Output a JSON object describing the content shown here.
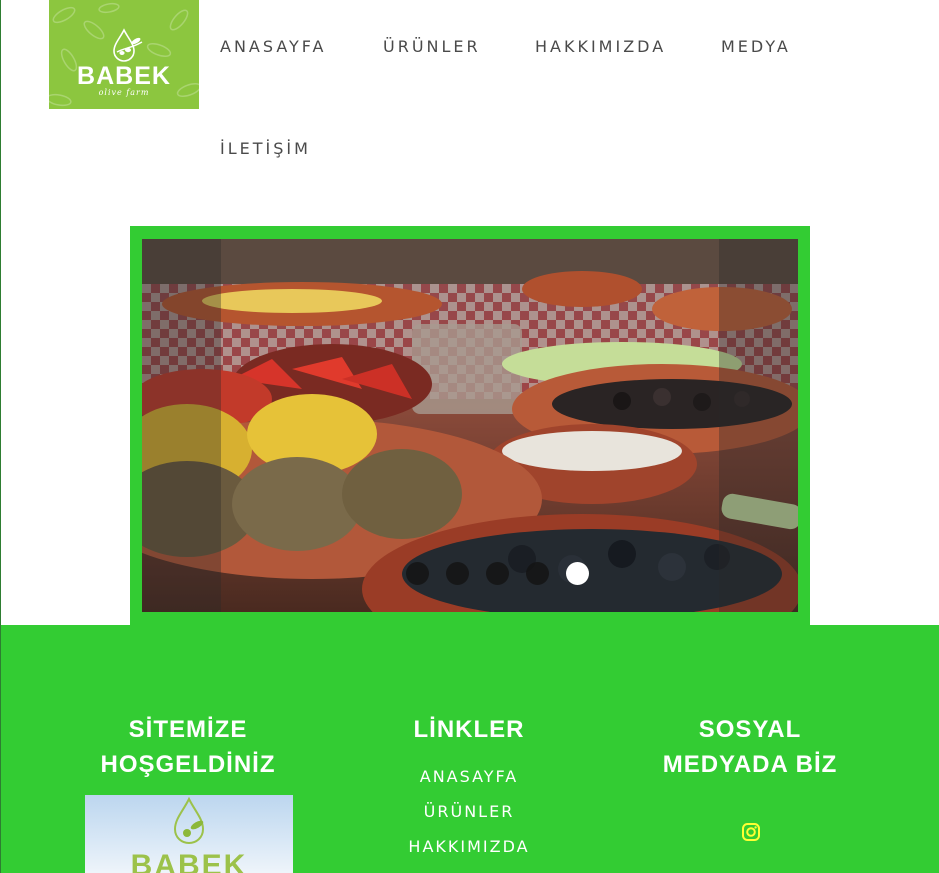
{
  "logo": {
    "brand": "BABEK",
    "sub": "olive farm",
    "color": "#8cc63f"
  },
  "nav": {
    "items": [
      {
        "label": "ANASAYFA"
      },
      {
        "label": "ÜRÜNLER"
      },
      {
        "label": "HAKKIMIZDA"
      },
      {
        "label": "MEDYA"
      },
      {
        "label": "İLETİŞİM"
      }
    ]
  },
  "slider": {
    "frame_color": "#33cc33",
    "slide_count": 5,
    "active_slide": 5
  },
  "footer": {
    "bg_color": "#33cc33",
    "welcome": {
      "title_line1": "SİTEMİZE",
      "title_line2": "HOŞGELDİNİZ",
      "image_text": "BABEK"
    },
    "links": {
      "title": "LİNKLER",
      "items": [
        "ANASAYFA",
        "ÜRÜNLER",
        "HAKKIMIZDA"
      ]
    },
    "social": {
      "title_line1": "SOSYAL",
      "title_line2": "MEDYADA BİZ",
      "icon": "instagram-icon",
      "icon_color": "#ffff33"
    }
  }
}
